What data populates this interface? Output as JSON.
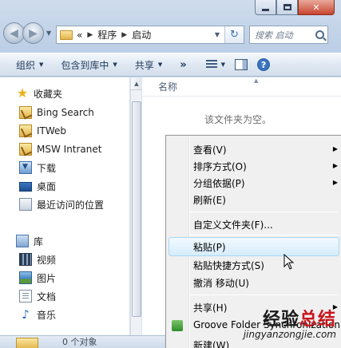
{
  "window": {
    "caption_minimize": "",
    "caption_maximize": "",
    "caption_close": "✕"
  },
  "address": {
    "overflow": "«",
    "crumbs": [
      "程序",
      "启动"
    ],
    "search_placeholder": "搜索 启动"
  },
  "toolbar": {
    "organize": "组织",
    "include_library": "包含到库中",
    "share": "共享",
    "more": "»"
  },
  "sidebar": {
    "favorites": "收藏夹",
    "items": [
      {
        "label": "Bing Search",
        "icon": "favorite-link-icon"
      },
      {
        "label": "ITWeb",
        "icon": "favorite-link-icon"
      },
      {
        "label": "MSW Intranet",
        "icon": "favorite-link-icon"
      },
      {
        "label": "下载",
        "icon": "download-folder-icon"
      },
      {
        "label": "桌面",
        "icon": "desktop-icon"
      },
      {
        "label": "最近访问的位置",
        "icon": "recent-places-icon"
      }
    ],
    "libraries": "库",
    "library_items": [
      {
        "label": "视频",
        "icon": "video-library-icon"
      },
      {
        "label": "图片",
        "icon": "picture-library-icon"
      },
      {
        "label": "文档",
        "icon": "document-library-icon"
      },
      {
        "label": "音乐",
        "icon": "music-library-icon"
      }
    ]
  },
  "content": {
    "column_name": "名称",
    "empty_message": "该文件夹为空。"
  },
  "status": {
    "text": "0 个对象"
  },
  "context_menu": {
    "items": [
      {
        "label": "查看(V)",
        "submenu": true
      },
      {
        "label": "排序方式(O)",
        "submenu": true
      },
      {
        "label": "分组依据(P)",
        "submenu": true
      },
      {
        "label": "刷新(E)",
        "submenu": false
      },
      {
        "label": "自定义文件夹(F)...",
        "submenu": false
      },
      {
        "label": "粘贴(P)",
        "submenu": false,
        "highlighted": true
      },
      {
        "label": "粘贴快捷方式(S)",
        "submenu": false
      },
      {
        "label": "撤消 移动(U)",
        "submenu": false
      },
      {
        "label": "共享(H)",
        "submenu": true
      },
      {
        "label": "Groove Folder Synchronization",
        "submenu": true
      },
      {
        "label": "新建(W)",
        "submenu": true
      }
    ]
  },
  "watermark": {
    "main_black": "经验",
    "main_red": "总结",
    "sub": "jingyanzongjie.com"
  },
  "colors": {
    "highlight_border": "#a8d8f6",
    "watermark_red": "#c8151b"
  }
}
